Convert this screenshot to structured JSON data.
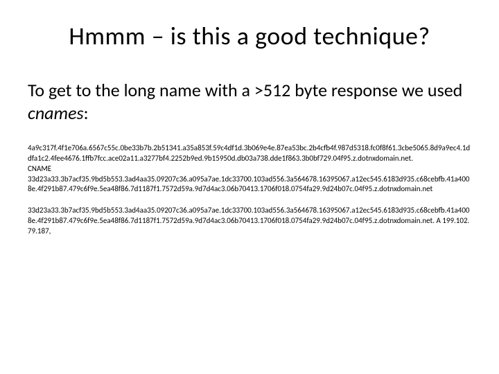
{
  "title": "Hmmm – is this a good technique?",
  "subtitle_pre": "To get to the long name with a >512 byte response we used ",
  "subtitle_em": "cnames",
  "subtitle_post": ":",
  "block1": "4a9c317f.4f1e706a.6567c55c.0be33b7b.2b51341.a35a853f.59c4df1d.3b069e4e.87ea53bc.2b4cfb4f.987d5318.fc0f8f61.3cbe5065.8d9a9ec4.1ddfa1c2.4fee4676.1ffb7fcc.ace02a11.a3277bf4.2252b9ed.9b15950d.db03a738.dde1f863.3b0bf729.04f95.z.dotnxdomain.net.",
  "block1_cname": "CNAME",
  "block1b": "33d23a33.3b7acf35.9bd5b553.3ad4aa35.09207c36.a095a7ae.1dc33700.103ad556.3a564678.16395067.a12ec545.6183d935.c68cebfb.41a4008e.4f291b87.479c6f9e.5ea48f86.7d1187f1.7572d59a.9d7d4ac3.06b70413.1706f018.0754fa29.9d24b07c.04f95.z.dotnxdomain.net",
  "block2": "33d23a33.3b7acf35.9bd5b553.3ad4aa35.09207c36.a095a7ae.1dc33700.103ad556.3a564678.16395067.a12ec545.6183d935.c68cebfb.41a4008e.4f291b87.479c6f9e.5ea48f86.7d1187f1.7572d59a.9d7d4ac3.06b70413.1706f018.0754fa29.9d24b07c.04f95.z.dotnxdomain.net. A 199.102.79.187,"
}
